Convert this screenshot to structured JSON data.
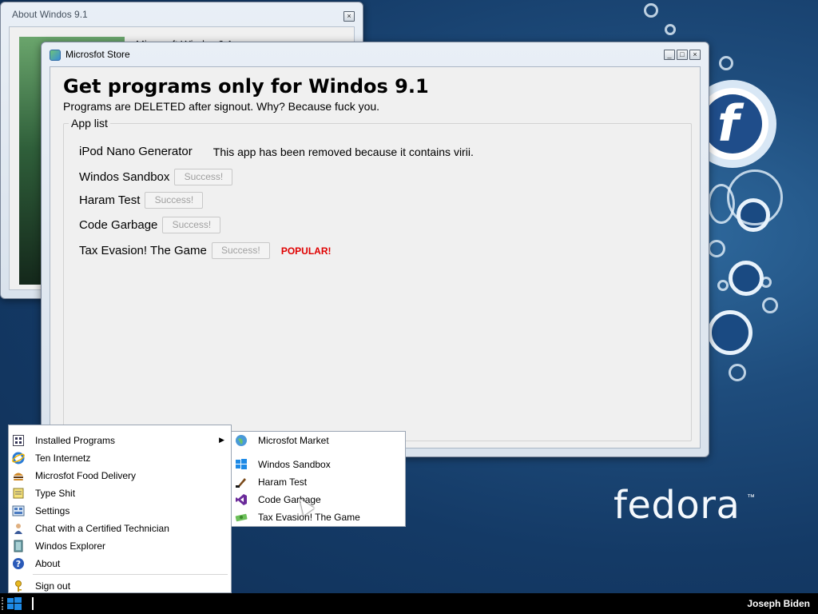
{
  "desktop": {
    "wallpaper_brand": "fedora",
    "trademark": "™",
    "logo_letter": "f"
  },
  "about_window": {
    "title": "About Windos 9.1",
    "caption": "Microsoft Windos 9.1"
  },
  "store_window": {
    "title": "Microsfot Store",
    "heading": "Get programs only for Windos 9.1",
    "subheading": "Programs are DELETED after signout. Why? Because fuck you.",
    "group_label": "App list",
    "apps": [
      {
        "name": "iPod Nano Generator",
        "message": "This app has been removed because it contains virii."
      },
      {
        "name": "Windos Sandbox",
        "button": "Success!"
      },
      {
        "name": "Haram Test",
        "button": "Success!"
      },
      {
        "name": "Code Garbage",
        "button": "Success!"
      },
      {
        "name": "Tax Evasion! The Game",
        "button": "Success!",
        "badge": "POPULAR!"
      }
    ]
  },
  "start_menu": {
    "items": [
      {
        "label": "Installed Programs",
        "icon": "grid-icon"
      },
      {
        "label": "Ten Internetz",
        "icon": "ie-icon"
      },
      {
        "label": "Microsfot Food Delivery",
        "icon": "burger-icon"
      },
      {
        "label": "Type Shit",
        "icon": "notepad-icon"
      },
      {
        "label": "Settings",
        "icon": "settings-icon"
      },
      {
        "label": "Chat with a Certified Technician",
        "icon": "person-icon"
      },
      {
        "label": "Windos Explorer",
        "icon": "explorer-icon"
      },
      {
        "label": "About",
        "icon": "help-icon"
      },
      {
        "label": "Sign out",
        "icon": "key-icon"
      }
    ],
    "submenu_arrow": "▶"
  },
  "submenu": {
    "items": [
      {
        "label": "Microsfot Market",
        "icon": "globe-icon"
      },
      {
        "label": "Windos Sandbox",
        "icon": "windows-icon"
      },
      {
        "label": "Haram Test",
        "icon": "brush-icon"
      },
      {
        "label": "Code Garbage",
        "icon": "vs-icon"
      },
      {
        "label": "Tax Evasion! The Game",
        "icon": "money-icon"
      }
    ]
  },
  "taskbar": {
    "user": "Joseph Biden"
  },
  "window_controls": {
    "minimize": "_",
    "maximize": "□",
    "close": "×"
  }
}
